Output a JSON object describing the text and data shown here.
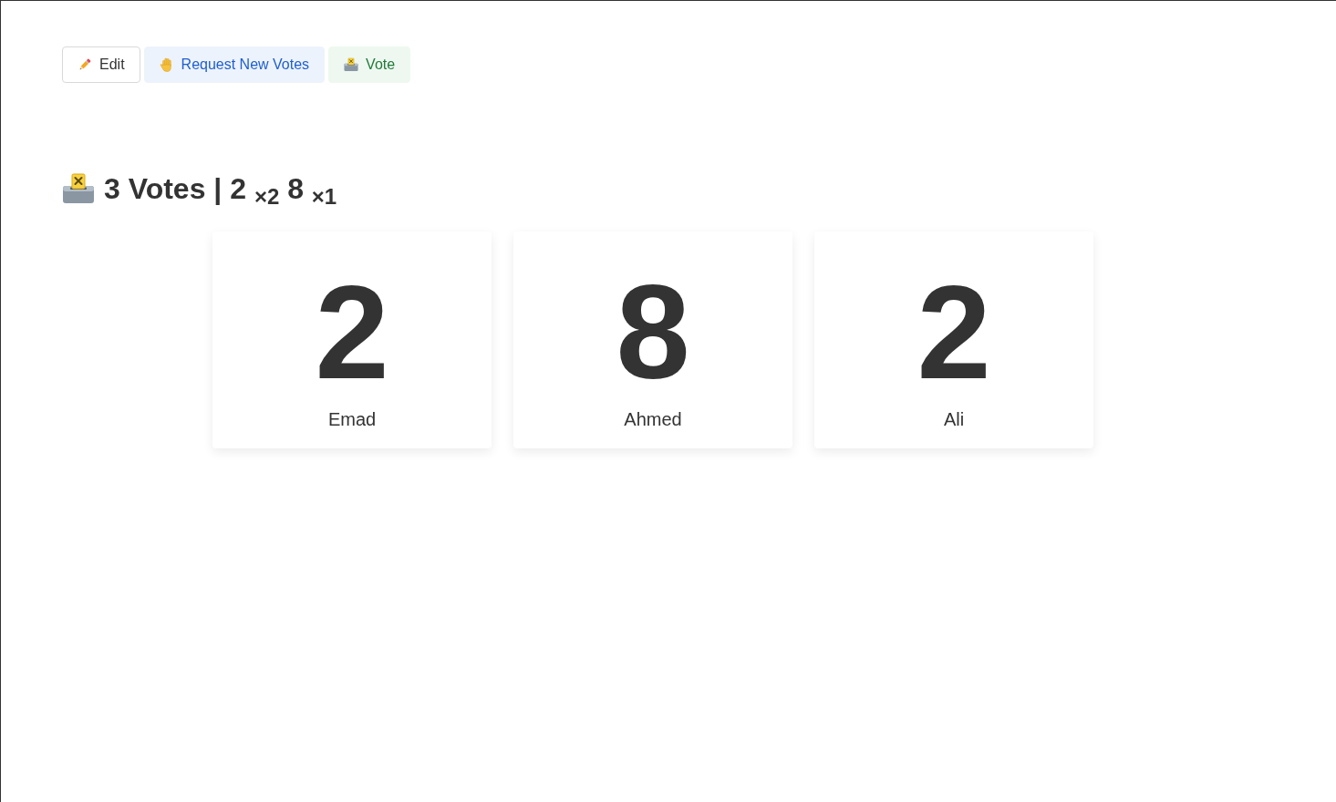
{
  "toolbar": {
    "buttons": [
      {
        "label": "Edit",
        "kind": "outline"
      },
      {
        "label": "Request New Votes",
        "kind": "info"
      },
      {
        "label": "Vote",
        "kind": "success"
      }
    ]
  },
  "summary": {
    "text": "3 Votes | 2 $_{×2}$ 8 $_{×1}$"
  },
  "cards": [
    {
      "value": "2",
      "name": "Emad"
    },
    {
      "value": "8",
      "name": "Ahmed"
    },
    {
      "value": "2",
      "name": "Ali"
    }
  ]
}
